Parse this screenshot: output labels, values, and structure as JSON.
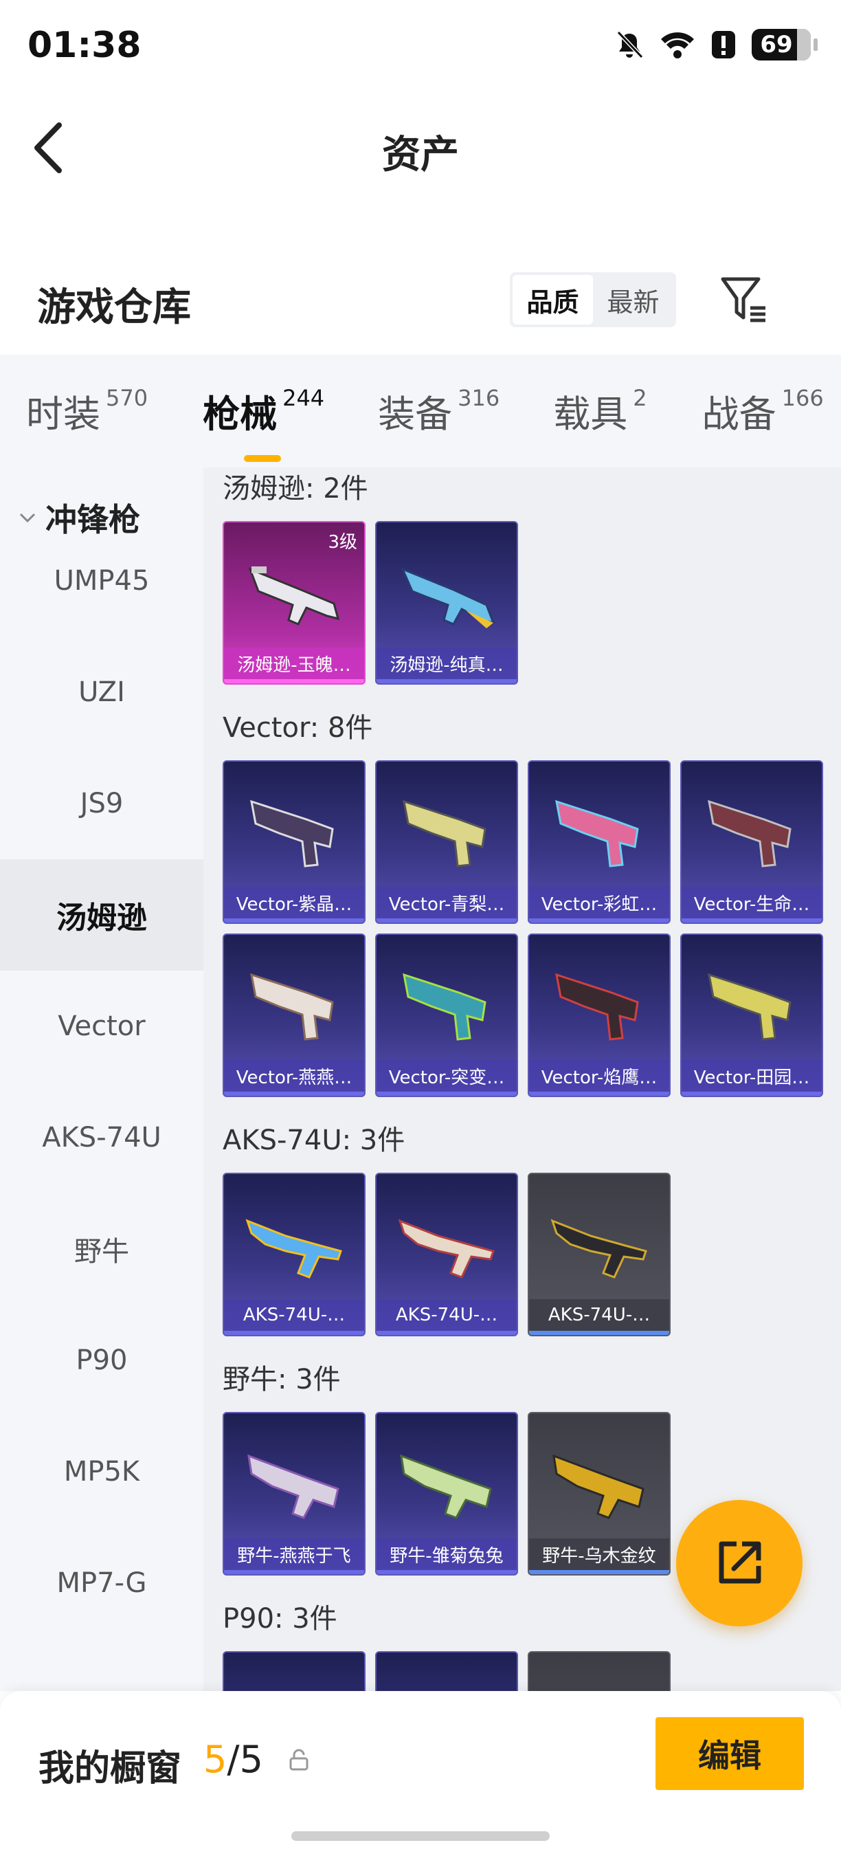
{
  "status": {
    "time": "01:38",
    "battery": "69"
  },
  "header": {
    "title": "资产"
  },
  "section": {
    "title": "游戏仓库",
    "sort_options": [
      "品质",
      "最新"
    ],
    "sort_selected": "品质"
  },
  "tabs": [
    {
      "label": "时装",
      "count": "570"
    },
    {
      "label": "枪械",
      "count": "244"
    },
    {
      "label": "装备",
      "count": "316"
    },
    {
      "label": "载具",
      "count": "2"
    },
    {
      "label": "战备",
      "count": "166"
    }
  ],
  "sidebar": {
    "heading": "冲锋枪",
    "items": [
      "UMP45",
      "UZI",
      "JS9",
      "汤姆逊",
      "Vector",
      "AKS-74U",
      "野牛",
      "P90",
      "MP5K",
      "MP7-G"
    ],
    "active": "汤姆逊"
  },
  "groups": [
    {
      "title": "汤姆逊: 2件",
      "items": [
        {
          "name": "汤姆逊-玉魄…",
          "grade": "3级"
        },
        {
          "name": "汤姆逊-纯真…"
        }
      ]
    },
    {
      "title": "Vector: 8件",
      "items": [
        {
          "name": "Vector-紫晶…"
        },
        {
          "name": "Vector-青梨…"
        },
        {
          "name": "Vector-彩虹…"
        },
        {
          "name": "Vector-生命…"
        },
        {
          "name": "Vector-燕燕…"
        },
        {
          "name": "Vector-突变…"
        },
        {
          "name": "Vector-焰鹰…"
        },
        {
          "name": "Vector-田园…"
        }
      ]
    },
    {
      "title": "AKS-74U: 3件",
      "items": [
        {
          "name": "AKS-74U-…"
        },
        {
          "name": "AKS-74U-…"
        },
        {
          "name": "AKS-74U-…"
        }
      ]
    },
    {
      "title": "野牛: 3件",
      "items": [
        {
          "name": "野牛-燕燕于飞"
        },
        {
          "name": "野牛-雏菊兔兔"
        },
        {
          "name": "野牛-乌木金纹"
        }
      ]
    },
    {
      "title": "P90: 3件",
      "items": []
    }
  ],
  "bottom": {
    "window_label": "我的橱窗",
    "window_count": "5",
    "window_sep": "/",
    "window_total": "5",
    "edit_label": "编辑"
  },
  "colors": {
    "accent": "#ffb300",
    "card_purple": "#3b3888",
    "card_pink": "#b02fa3",
    "card_gray": "#55565f"
  },
  "icons": [
    "back-arrow-icon",
    "filter-icon",
    "share-icon",
    "lock-icon",
    "chevron-down-icon",
    "mute-icon",
    "wifi-icon",
    "alert-icon"
  ]
}
